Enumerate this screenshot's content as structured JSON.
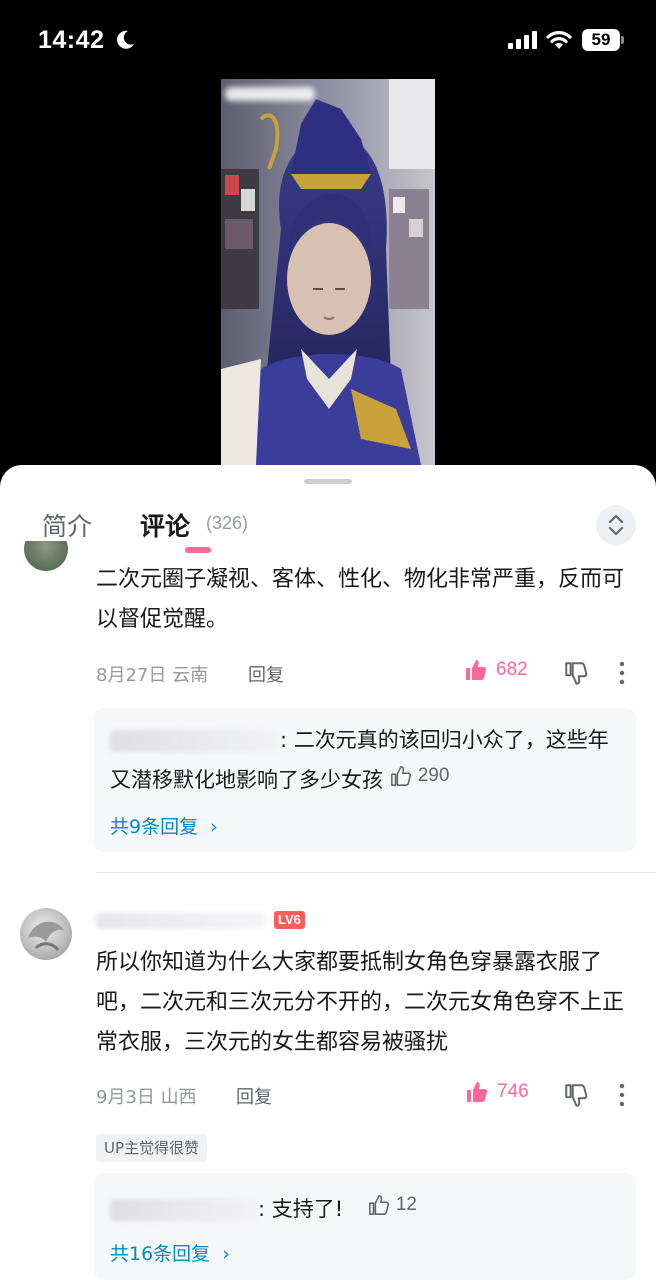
{
  "status_bar": {
    "time": "14:42",
    "battery": "59"
  },
  "tabs": {
    "intro": "简介",
    "comments": "评论",
    "comments_count": "(326)"
  },
  "comment1": {
    "text": "二次元圈子凝视、客体、性化、物化非常严重，反而可以督促觉醒。",
    "date_location": "8月27日 云南",
    "reply_label": "回复",
    "likes": "682",
    "reply": {
      "text": ": 二次元真的该回归小众了，这些年又潜移默化地影响了多少女孩",
      "likes": "290"
    },
    "more_replies": "共9条回复"
  },
  "comment2": {
    "level": "LV6",
    "text": "所以你知道为什么大家都要抵制女角色穿暴露衣服了吧，二次元和三次元分不开的，二次元女角色穿不上正常衣服，三次元的女生都容易被骚扰",
    "date_location": "9月3日 山西",
    "reply_label": "回复",
    "likes": "746",
    "up_badge": "UP主觉得很赞",
    "reply": {
      "text": ": 支持了!",
      "likes": "12"
    },
    "more_replies": "共16条回复"
  },
  "colors": {
    "accent": "#ff6699",
    "link": "#008ac5",
    "muted": "#9499a0"
  }
}
